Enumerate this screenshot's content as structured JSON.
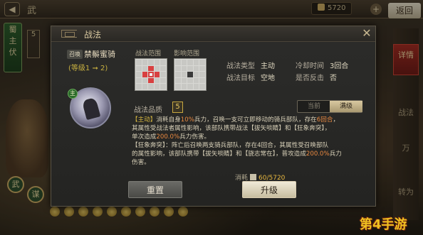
{
  "topbar": {
    "back": "◀",
    "title": "武",
    "resource": "5720",
    "return_label": "返回",
    "plus": "+"
  },
  "left_side": {
    "banner": [
      "蜀",
      "主",
      "伏"
    ],
    "num": "5",
    "badges": [
      "武",
      "谋"
    ]
  },
  "right_side": {
    "tabs": [
      "详情",
      "战法",
      "万",
      "转为"
    ]
  },
  "dialog": {
    "title": "战法",
    "tag": "召唤",
    "tactic_name": "禁鬃蜜骑",
    "level_text": "(等级1 ➞ 2)",
    "portrait_badge": "主",
    "range_label_1": "战法范围",
    "range_label_2": "影响范围",
    "type_label": "战法类型",
    "type_value": "主动",
    "cooldown_label": "冷却时间",
    "cooldown_value": "3回合",
    "target_label": "战法目标",
    "target_value": "空地",
    "counter_label": "是否反击",
    "counter_value": "否",
    "quality_label": "战法品质",
    "quality_value": "5",
    "toggle_current": "当前",
    "toggle_max": "满级",
    "desc": {
      "l1a": "【主动】",
      "l1b": "消耗自身",
      "l1c": "10%",
      "l1d": "兵力，召唤一支可立即移动的骑兵部队，存在",
      "l1e": "6回合",
      "l1f": "，",
      "l2": "其属性受战法者属性影响，该部队携带战法【拔矢啖睛】和【狂象奔突】，",
      "l3a": "单次造成",
      "l3b": "200.0%",
      "l3c": "兵力伤害。",
      "l4": "【狂象奔突】：阵亡后召唤两支骑兵部队，存在4回合，其属性受召唤部队",
      "l5a": "的属性影响，该部队携带【拔矢啖睛】和【骁志常在】，普攻造成",
      "l5b": "200.0%",
      "l5c": "兵力",
      "l6": "伤害。"
    },
    "cost_label": "消耗",
    "cost_value": "60/5720",
    "reset_label": "重置",
    "upgrade_label": "升级"
  },
  "watermark": "第4手游"
}
